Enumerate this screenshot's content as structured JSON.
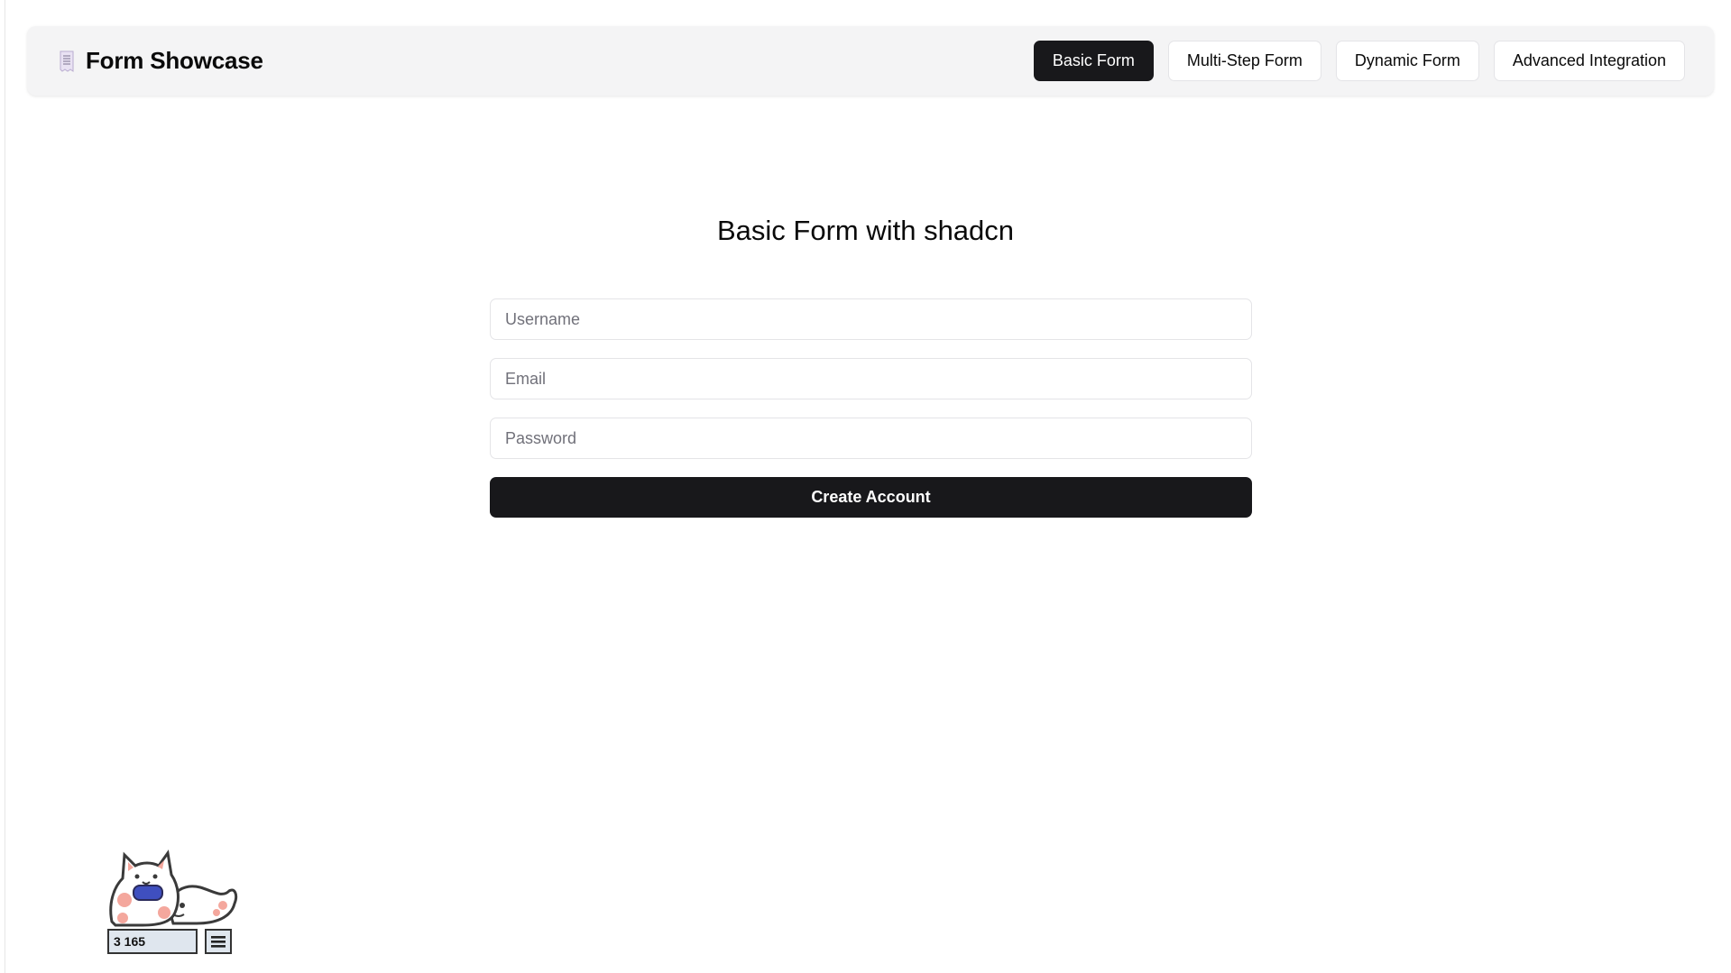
{
  "header": {
    "brand_icon": "receipt-icon",
    "title": "Form Showcase",
    "nav": [
      {
        "label": "Basic Form",
        "active": true
      },
      {
        "label": "Multi-Step Form",
        "active": false
      },
      {
        "label": "Dynamic Form",
        "active": false
      },
      {
        "label": "Advanced Integration",
        "active": false
      }
    ]
  },
  "form": {
    "title": "Basic Form with shadcn",
    "username_placeholder": "Username",
    "email_placeholder": "Email",
    "password_placeholder": "Password",
    "submit_label": "Create Account"
  },
  "pet": {
    "icon": "cat-gamer-icon",
    "counter": "3 165",
    "menu_icon": "hamburger-icon"
  },
  "colors": {
    "primary": "#18181b",
    "header_bg": "#f4f4f5",
    "border": "#e4e4e7",
    "placeholder": "#71717a"
  }
}
